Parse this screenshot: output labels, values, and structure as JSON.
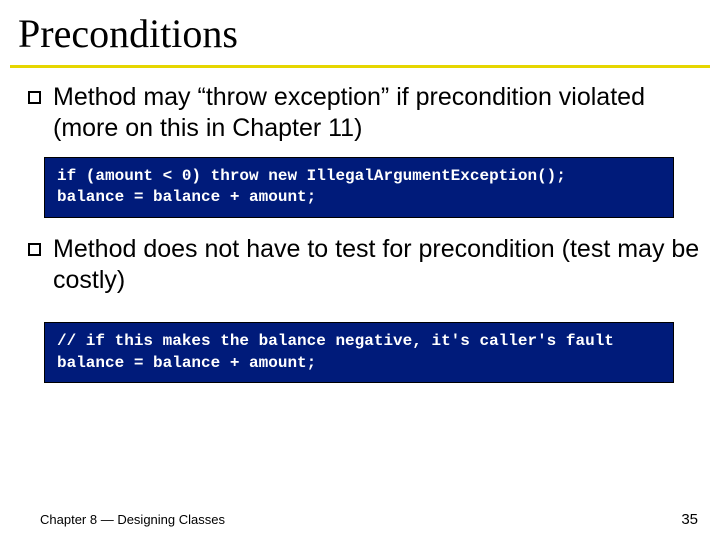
{
  "title": "Preconditions",
  "bullets": [
    "Method may “throw exception” if precondition violated (more on this in Chapter 11)",
    "Method does not have to test for precondition (test may be costly)"
  ],
  "code": [
    "if (amount < 0) throw new IllegalArgumentException();\nbalance = balance + amount;",
    "// if this makes the balance negative, it's caller's fault\nbalance = balance + amount;"
  ],
  "footer": {
    "left": "Chapter 8 — Designing Classes",
    "right": "35"
  }
}
